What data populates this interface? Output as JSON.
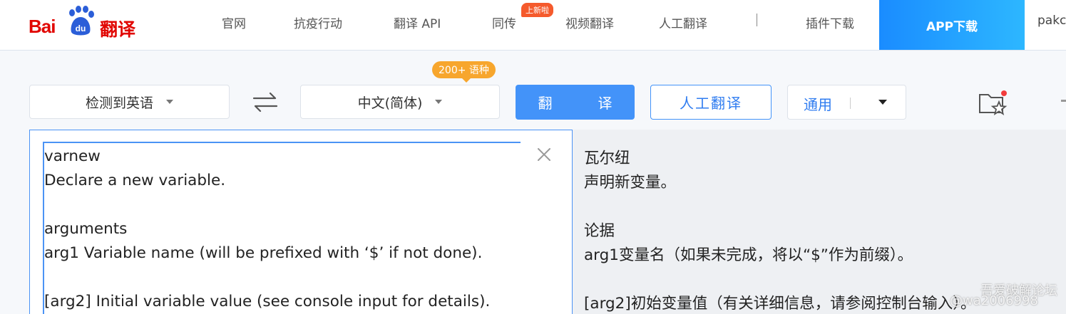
{
  "header": {
    "logo": {
      "bai": "Bai",
      "du": "du",
      "product": "翻译"
    },
    "nav": [
      {
        "label": "官网"
      },
      {
        "label": "抗疫行动"
      },
      {
        "label": "翻译 API"
      },
      {
        "label": "同传"
      },
      {
        "label": "视频翻译"
      },
      {
        "label": "人工翻译"
      },
      {
        "label": "插件下载"
      }
    ],
    "new_badge": "上新啦",
    "app_download": "APP下载",
    "user_partial": "pakc"
  },
  "toolbar": {
    "source_lang": "检测到英语",
    "target_lang": "中文(简体)",
    "lang_count_badge": "200+ 语种",
    "translate_button": "翻　译",
    "human_translate_button": "人工翻译",
    "domain": "通用"
  },
  "source": {
    "lines": [
      "varnew",
      "Declare a new variable.",
      "",
      "arguments",
      "arg1 Variable name (will be prefixed with ‘$’ if not done).",
      "",
      "[arg2] Initial variable value (see console input for details)."
    ]
  },
  "output": {
    "lines": [
      "瓦尔纽",
      "声明新变量。",
      "",
      "论据",
      "arg1变量名（如果未完成，将以“$”作为前缀）。",
      "",
      "[arg2]初始变量值（有关详细信息，请参阅控制台输入）。"
    ]
  },
  "watermark": {
    "forum": "吾爱破解论坛",
    "user": "@wa2006998"
  }
}
